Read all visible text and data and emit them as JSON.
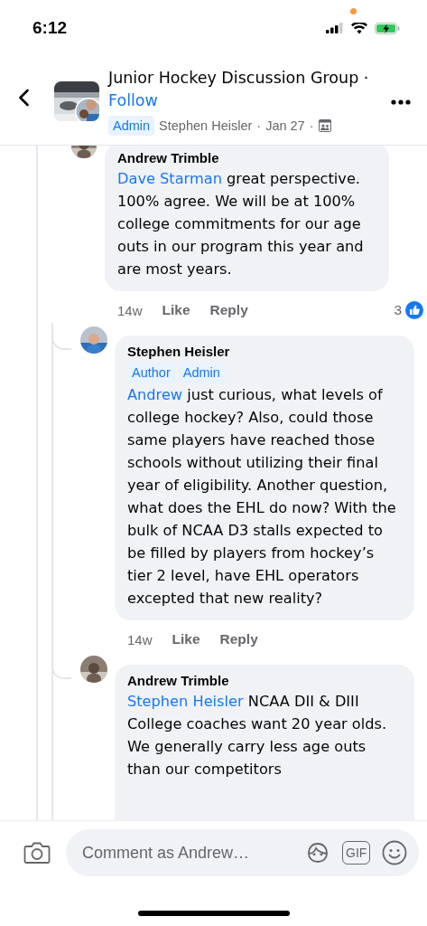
{
  "status_bar": {
    "time": "6:12"
  },
  "header": {
    "group_name": "Junior Hockey Discussion Group",
    "separator": "·",
    "follow": "Follow",
    "badge": "Admin",
    "author": "Stephen Heisler",
    "date": "Jan 27"
  },
  "comments": [
    {
      "author": "Andrew Trimble",
      "mention": "Dave Starman",
      "text": "great perspective. 100% agree.  We will be at 100% college commitments for our age outs in our program this year and are most years.",
      "time": "14w",
      "like": "Like",
      "reply": "Reply",
      "reactions": "3",
      "children": [
        {
          "author": "Stephen Heisler",
          "badges": [
            "Author",
            "Admin"
          ],
          "mention": "Andrew",
          "text": "just curious, what levels of college hockey? Also, could those same players have reached those schools without utilizing their final year of eligibility. Another question, what does the EHL do now? With the bulk of NCAA D3 stalls expected to be filled by players from hockey’s tier 2 level, have EHL operators excepted that new reality?",
          "time": "14w",
          "like": "Like",
          "reply": "Reply"
        },
        {
          "author": "Andrew Trimble",
          "mention": "Stephen Heisler",
          "text": "NCAA DII & DIII College coaches want 20 year olds.  We generally carry less age outs than our competitors"
        }
      ]
    }
  ],
  "composer": {
    "placeholder": "Comment as Andrew…",
    "gif_label": "GIF"
  }
}
